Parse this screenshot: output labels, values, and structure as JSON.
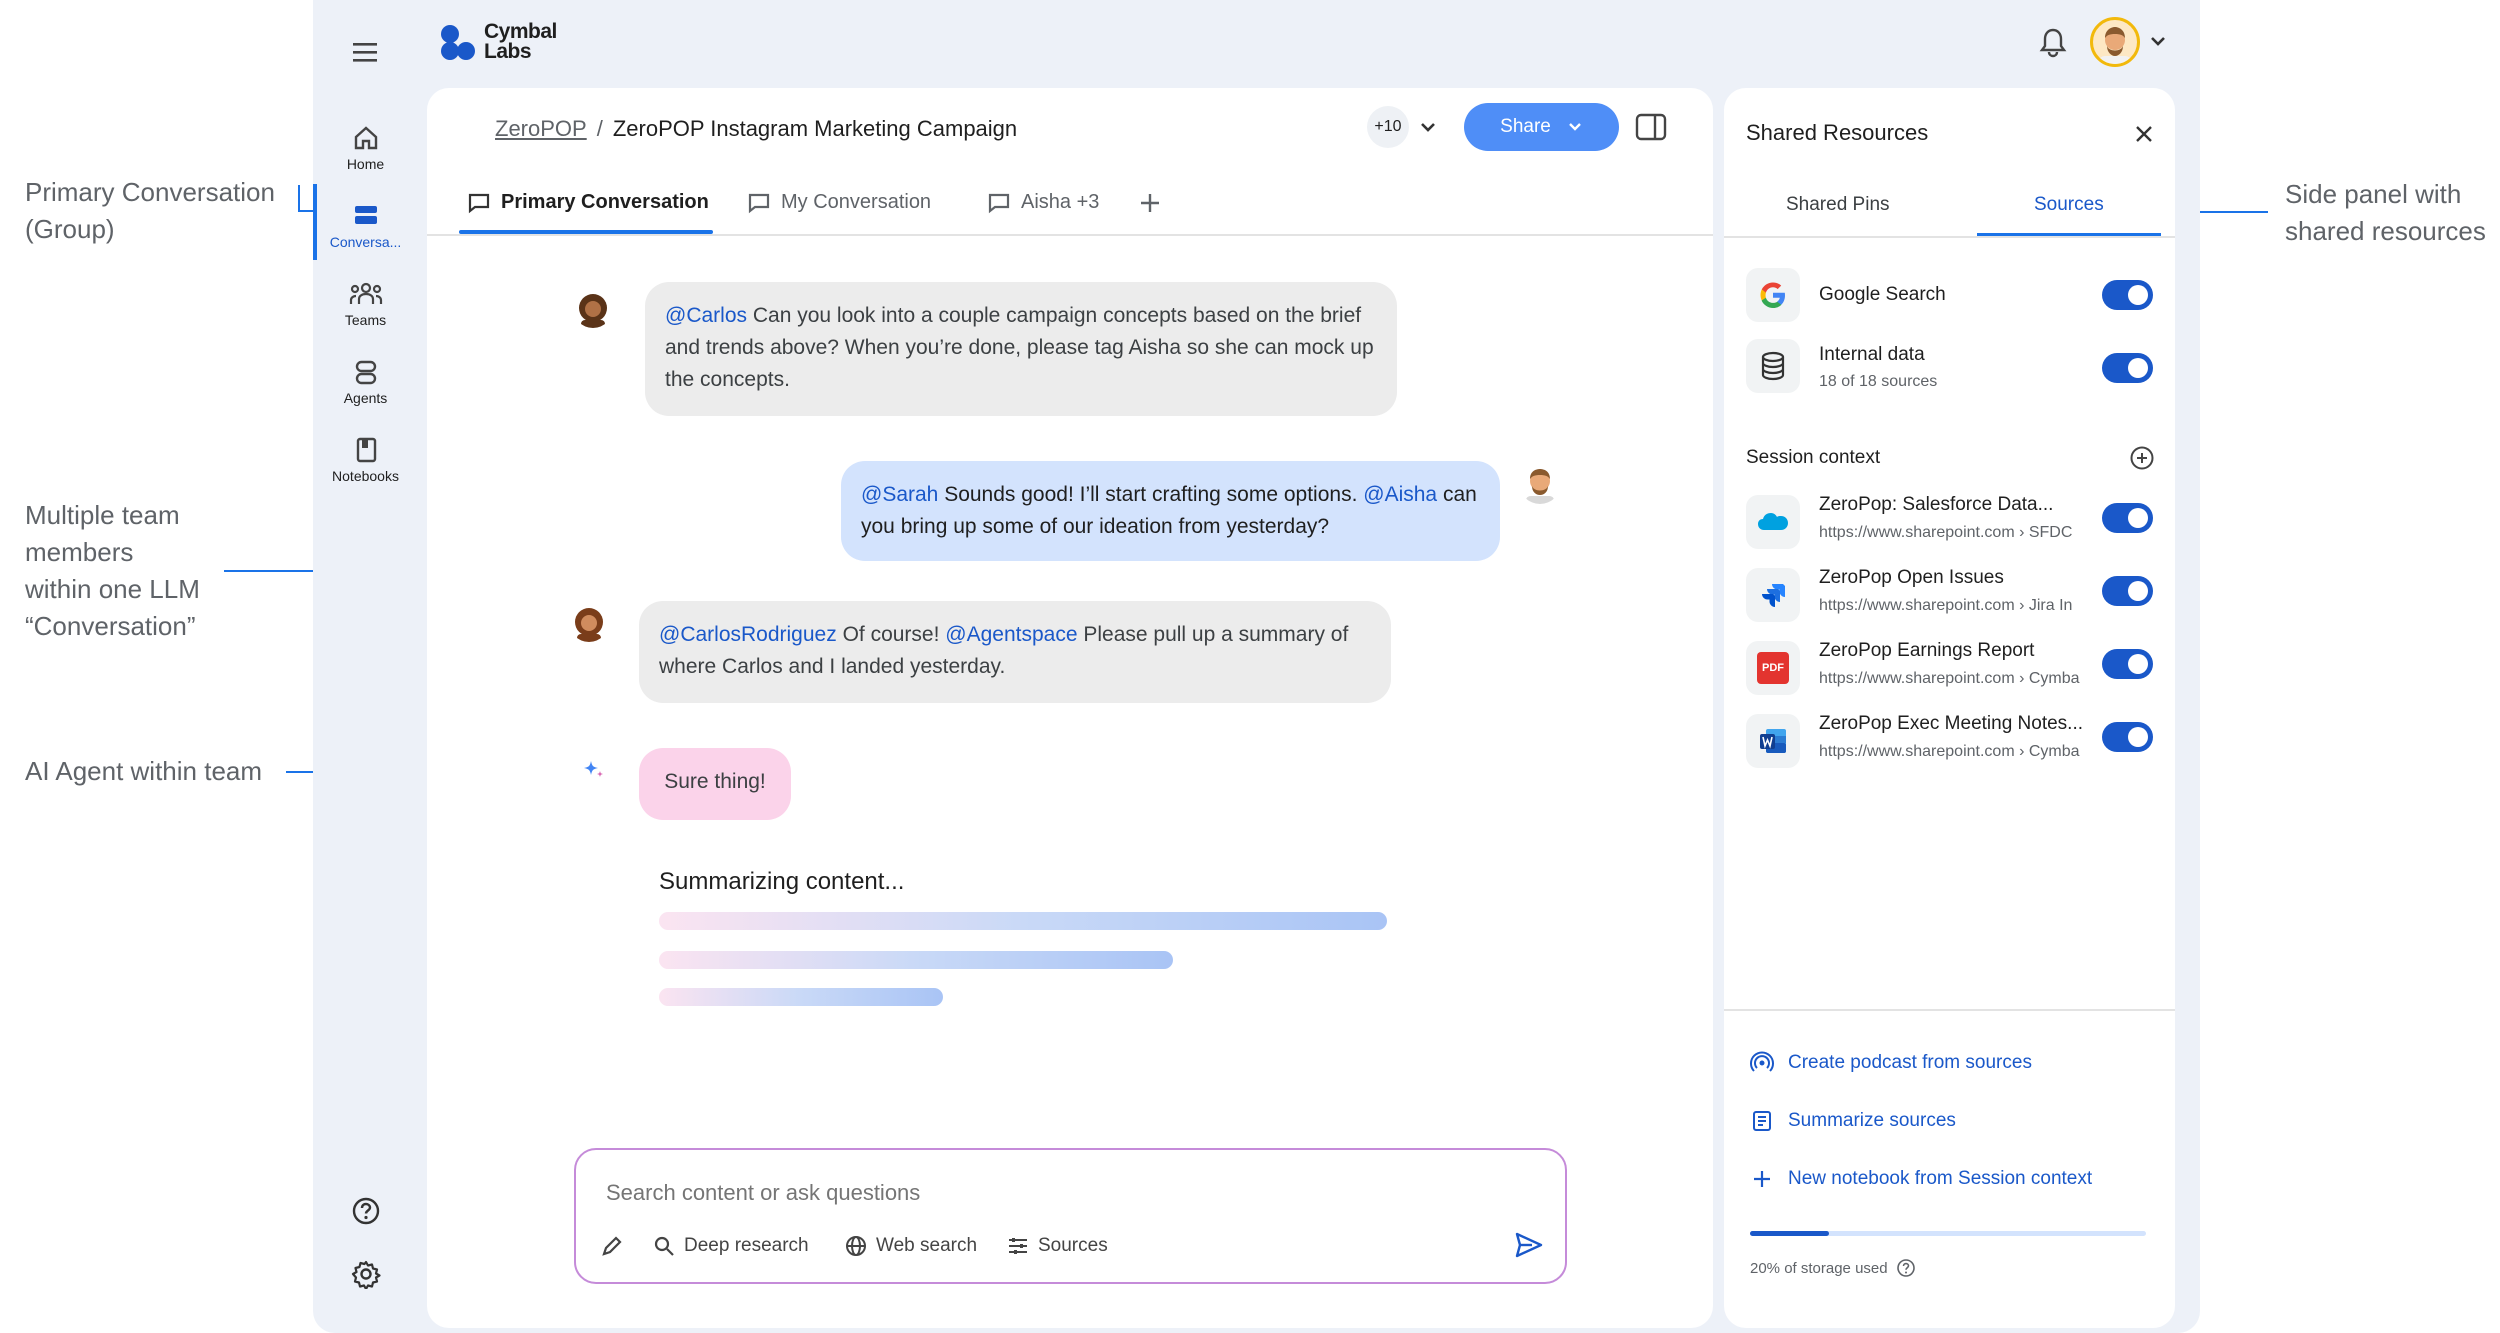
{
  "annotations": {
    "primary": [
      "Primary Conversation",
      "(Group)"
    ],
    "members": [
      "Multiple team",
      "members",
      "within one LLM",
      "“Conversation”"
    ],
    "agent": [
      "AI Agent within team"
    ],
    "side": [
      "Side panel with",
      "shared resources"
    ]
  },
  "app": {
    "logo_line1": "Cymbal",
    "logo_line2": "Labs"
  },
  "nav": {
    "home": "Home",
    "conversations": "Conversa...",
    "teams": "Teams",
    "agents": "Agents",
    "notebooks": "Notebooks"
  },
  "header": {
    "breadcrumb_root": "ZeroPOP",
    "breadcrumb_sep": "/",
    "breadcrumb_current": "ZeroPOP Instagram Marketing Campaign",
    "participants_count": "+10",
    "share_label": "Share"
  },
  "tabs": [
    {
      "label": "Primary Conversation"
    },
    {
      "label": "My Conversation"
    },
    {
      "label": "Aisha +3"
    }
  ],
  "messages": [
    {
      "mention": "@Carlos",
      "text": " Can you look into a couple campaign concepts based on the brief and trends above? When you’re done, please tag Aisha so she can mock up the concepts."
    },
    {
      "mention": "@Sarah",
      "text": " Sounds good! I’ll start crafting some options. ",
      "mention2": "@Aisha",
      "text2": " can you bring up some of our ideation from yesterday?"
    },
    {
      "mention": "@CarlosRodriguez",
      "text": " Of course! ",
      "mention2": "@Agentspace",
      "text2": " Please pull up a summary of where Carlos and I landed yesterday."
    },
    {
      "text": "Sure thing!"
    }
  ],
  "summarizing_label": "Summarizing content...",
  "summary_progress": [
    1.0,
    0.7,
    0.39
  ],
  "input": {
    "placeholder": "Search content or ask questions",
    "tools": [
      "Deep research",
      "Web search",
      "Sources"
    ]
  },
  "side_panel": {
    "title": "Shared Resources",
    "tabs": [
      "Shared Pins",
      "Sources"
    ],
    "sources": [
      {
        "title": "Google Search",
        "subtitle": "",
        "icon": "google-icon",
        "enabled": true
      },
      {
        "title": "Internal data",
        "subtitle": "18 of 18 sources",
        "icon": "database-icon",
        "enabled": true
      }
    ],
    "session_context_label": "Session context",
    "session_items": [
      {
        "title": "ZeroPop: Salesforce Data...",
        "subtitle": "https://www.sharepoint.com › SFDC",
        "icon": "salesforce-icon",
        "enabled": true
      },
      {
        "title": "ZeroPop Open Issues",
        "subtitle": "https://www.sharepoint.com › Jira In",
        "icon": "jira-icon",
        "enabled": true
      },
      {
        "title": "ZeroPop Earnings Report",
        "subtitle": "https://www.sharepoint.com › Cymba",
        "icon": "pdf-icon",
        "enabled": true
      },
      {
        "title": "ZeroPop Exec Meeting Notes...",
        "subtitle": "https://www.sharepoint.com › Cymba",
        "icon": "word-icon",
        "enabled": true
      }
    ],
    "actions": [
      "Create podcast from sources",
      "Summarize sources",
      "New notebook from Session context"
    ],
    "storage_label": "20% of storage used",
    "storage_fraction": 0.2,
    "pdf_badge": "PDF"
  },
  "colors": {
    "accent": "#1a73e8",
    "mention": "#1a58c9",
    "agent_bubble": "#fbd3ea",
    "user_bubble": "#d3e3fd",
    "other_bubble": "#ececec"
  }
}
